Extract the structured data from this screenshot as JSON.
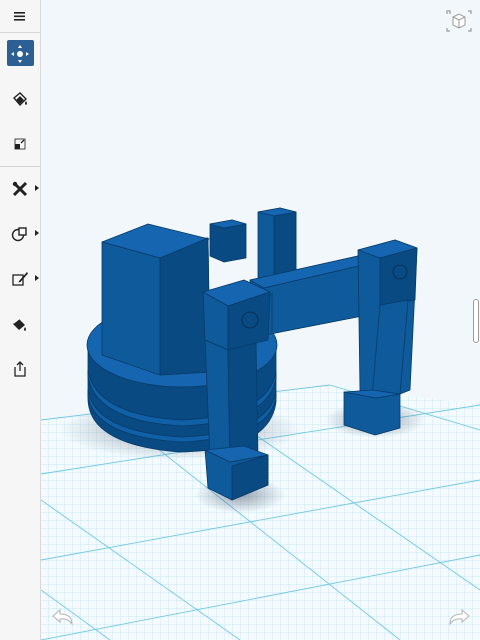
{
  "toolbar": {
    "items": [
      {
        "id": "menu",
        "icon": "hamburger-menu-icon"
      },
      {
        "id": "transform",
        "icon": "move-gizmo-icon",
        "active": true
      },
      {
        "id": "material",
        "icon": "paint-bucket-icon"
      },
      {
        "id": "snap",
        "icon": "snap-icon"
      },
      {
        "id": "modify",
        "icon": "tools-icon",
        "has_submenu": true
      },
      {
        "id": "primitives",
        "icon": "shapes-icon",
        "has_submenu": true
      },
      {
        "id": "sketch",
        "icon": "pencil-icon",
        "has_submenu": true
      },
      {
        "id": "paint",
        "icon": "paint-icon"
      },
      {
        "id": "export",
        "icon": "share-icon"
      }
    ]
  },
  "colors": {
    "model_top": "#1060a8",
    "model_front": "#0e5a9a",
    "model_side": "#0a4a82",
    "grid": "#7ed0e8",
    "background": "#f2f7fb",
    "accent": "#2c5f93"
  },
  "viewport": {
    "view_cube_icon": "view-cube-icon",
    "undo_icon": "undo-icon",
    "redo_icon": "redo-icon"
  }
}
